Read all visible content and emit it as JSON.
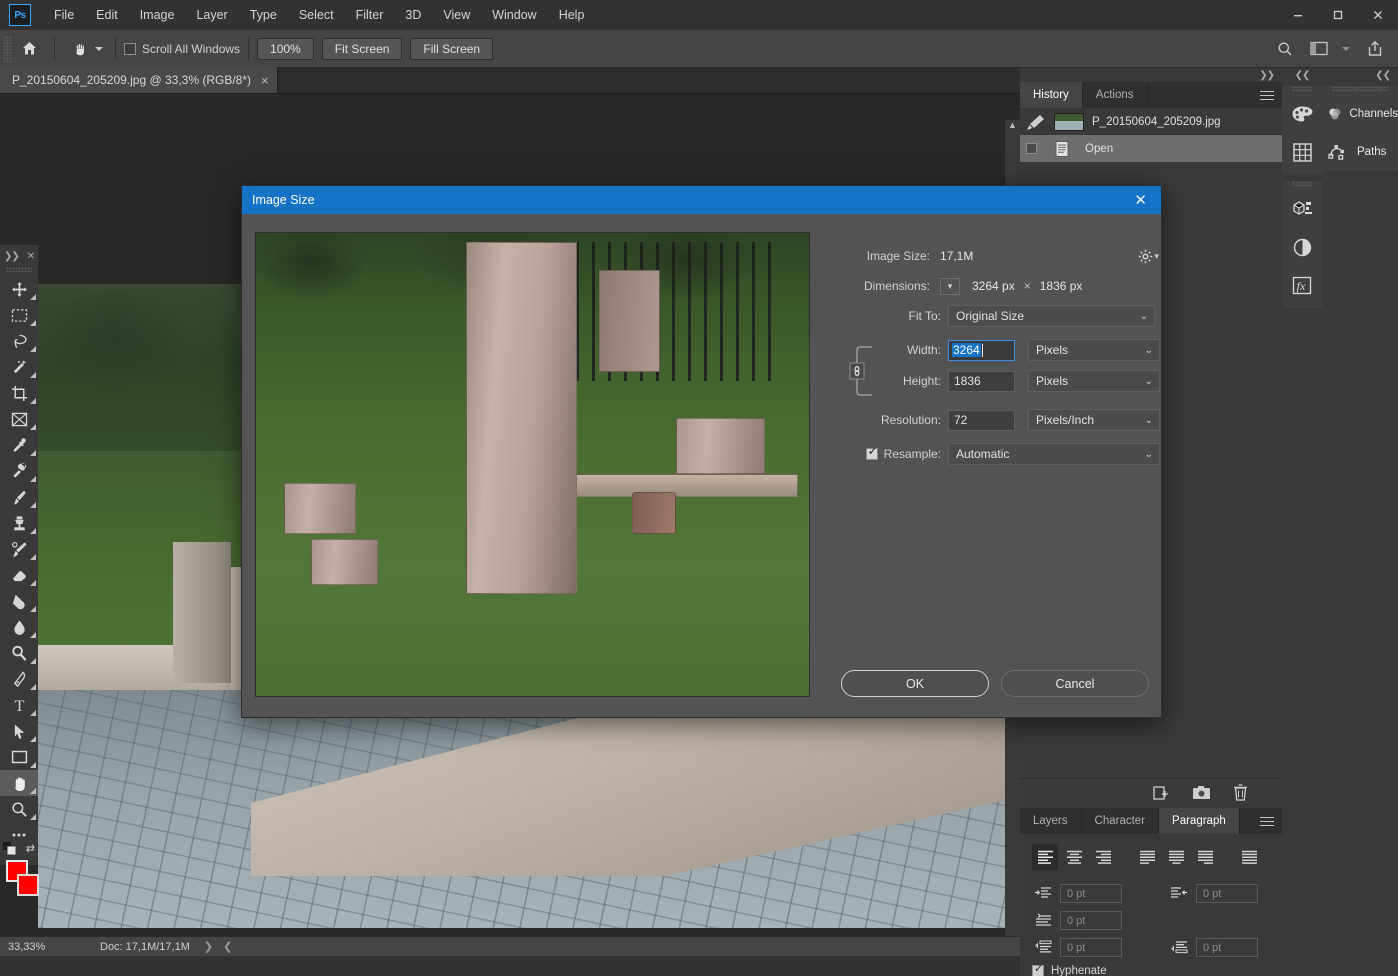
{
  "app": {
    "logo": "Ps",
    "menus": [
      "File",
      "Edit",
      "Image",
      "Layer",
      "Type",
      "Select",
      "Filter",
      "3D",
      "View",
      "Window",
      "Help"
    ],
    "window_controls": [
      "minimize-icon",
      "maximize-icon",
      "close-icon"
    ]
  },
  "options_bar": {
    "home_icon": "home-icon",
    "tool_icon": "hand-tool-icon",
    "scroll_all_windows_label": "Scroll All Windows",
    "scroll_all_windows_checked": false,
    "buttons": [
      "100%",
      "Fit Screen",
      "Fill Screen"
    ],
    "right_icons": [
      "search-icon",
      "workspace-icon",
      "share-icon"
    ]
  },
  "toolbar": {
    "tools": [
      {
        "name": "move-tool",
        "active": false
      },
      {
        "name": "rectangular-marquee-tool",
        "active": false
      },
      {
        "name": "lasso-tool",
        "active": false
      },
      {
        "name": "magic-wand-tool",
        "active": false
      },
      {
        "name": "crop-tool",
        "active": false
      },
      {
        "name": "frame-tool",
        "active": false
      },
      {
        "name": "eyedropper-tool",
        "active": false
      },
      {
        "name": "healing-brush-tool",
        "active": false
      },
      {
        "name": "brush-tool",
        "active": false
      },
      {
        "name": "clone-stamp-tool",
        "active": false
      },
      {
        "name": "history-brush-tool",
        "active": false
      },
      {
        "name": "eraser-tool",
        "active": false
      },
      {
        "name": "gradient-tool",
        "active": false
      },
      {
        "name": "blur-tool",
        "active": false
      },
      {
        "name": "dodge-tool",
        "active": false
      },
      {
        "name": "pen-tool",
        "active": false
      },
      {
        "name": "type-tool",
        "active": false
      },
      {
        "name": "path-selection-tool",
        "active": false
      },
      {
        "name": "rectangle-tool",
        "active": false
      },
      {
        "name": "hand-tool",
        "active": true
      },
      {
        "name": "zoom-tool",
        "active": false
      },
      {
        "name": "edit-toolbar-tool",
        "active": false
      }
    ],
    "foreground_color": "#fe0000",
    "background_color": "#fe0000"
  },
  "document": {
    "tab_title": "P_20150604_205209.jpg @ 33,3% (RGB/8*)",
    "close_glyph": "×"
  },
  "status_bar": {
    "zoom": "33,33%",
    "doc_info": "Doc: 17,1M/17,1M"
  },
  "history_panel": {
    "tabs": [
      {
        "label": "History",
        "active": true
      },
      {
        "label": "Actions",
        "active": false
      }
    ],
    "items": [
      {
        "label": "P_20150604_205209.jpg",
        "type": "snapshot",
        "selected": false
      },
      {
        "label": "Open",
        "type": "state",
        "selected": true
      }
    ],
    "footer_icons": [
      "new-document-icon",
      "camera-snapshot-icon",
      "trash-icon"
    ]
  },
  "paragraph_panel": {
    "tabs": [
      {
        "label": "Layers",
        "active": false
      },
      {
        "label": "Character",
        "active": false
      },
      {
        "label": "Paragraph",
        "active": true
      }
    ],
    "alignment_buttons": [
      "align-left-icon",
      "align-center-icon",
      "align-right-icon",
      "justify-last-left-icon",
      "justify-last-center-icon",
      "justify-last-right-icon",
      "justify-all-icon"
    ],
    "active_alignment": 0,
    "indent_fields": [
      {
        "name": "indent-left-margin",
        "value": "0 pt"
      },
      {
        "name": "indent-right-margin",
        "value": "0 pt"
      },
      {
        "name": "indent-first-line",
        "value": "0 pt"
      },
      {
        "name": "space-before-paragraph",
        "value": "0 pt"
      },
      {
        "name": "space-after-paragraph",
        "value": "0 pt"
      }
    ],
    "hyphenate_label": "Hyphenate",
    "hyphenate_checked": true
  },
  "icon_rail": {
    "groups": [
      [
        "color-palette-icon",
        "swatches-grid-icon"
      ],
      [
        "properties-3d-icon",
        "adjustments-icon",
        "layer-styles-fx-icon"
      ]
    ]
  },
  "named_panels": [
    {
      "label": "Channels",
      "icon": "channels-icon"
    },
    {
      "label": "Paths",
      "icon": "paths-icon"
    }
  ],
  "dialog": {
    "title": "Image Size",
    "close_glyph": "✕",
    "image_size_label": "Image Size:",
    "image_size_value": "17,1M",
    "gear_icon": "gear-icon",
    "dimensions_label": "Dimensions:",
    "dimensions_width": "3264 px",
    "dimensions_separator": "×",
    "dimensions_height": "1836 px",
    "fit_to_label": "Fit To:",
    "fit_to_value": "Original Size",
    "width_label": "Width:",
    "width_value": "3264",
    "width_unit": "Pixels",
    "width_focused": true,
    "height_label": "Height:",
    "height_value": "1836",
    "height_unit": "Pixels",
    "resolution_label": "Resolution:",
    "resolution_value": "72",
    "resolution_unit": "Pixels/Inch",
    "resample_label": "Resample:",
    "resample_checked": true,
    "resample_value": "Automatic",
    "link_icon": "chain-link-icon",
    "ok_label": "OK",
    "cancel_label": "Cancel"
  },
  "colors": {
    "accent_blue": "#1473c6",
    "panel_bg": "#393939",
    "dialog_bg": "#535353",
    "canvas_bg": "#282828",
    "foreground_swatch": "#fe0000"
  }
}
